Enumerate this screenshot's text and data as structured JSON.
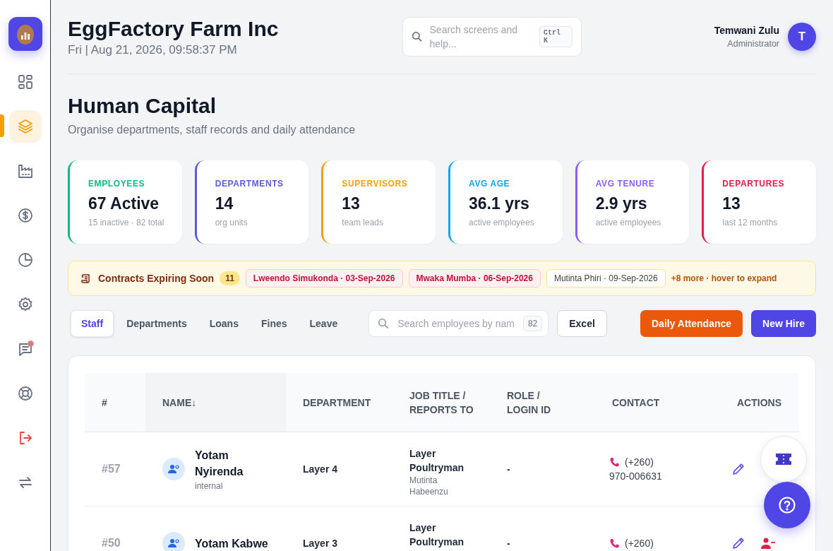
{
  "sidebar": {
    "items": [
      {
        "selected": false,
        "notification": false
      },
      {
        "selected": true,
        "notification": false
      },
      {
        "selected": false,
        "notification": false
      },
      {
        "selected": false,
        "notification": false
      },
      {
        "selected": false,
        "notification": false
      },
      {
        "selected": false,
        "notification": false
      },
      {
        "selected": false,
        "notification": true
      },
      {
        "selected": false,
        "notification": false
      },
      {
        "selected": false,
        "notification": false
      },
      {
        "selected": false,
        "notification": false
      }
    ]
  },
  "header": {
    "company": "EggFactory Farm Inc",
    "datetime": "Fri | Aug 21, 2026, 09:58:37 PM",
    "search": {
      "placeholder": "Search screens and help...",
      "shortcut": "Ctrl K"
    },
    "user": {
      "name": "Temwani Zulu",
      "role": "Administrator",
      "initial": "T"
    }
  },
  "page": {
    "title": "Human Capital",
    "subtitle": "Organise departments, staff records and daily attendance"
  },
  "stats": [
    {
      "label": "EMPLOYEES",
      "value": "67 Active",
      "note": "15 inactive · 82 total",
      "color": "#10b981"
    },
    {
      "label": "DEPARTMENTS",
      "value": "14",
      "note": "org units",
      "color": "#5b5bd6"
    },
    {
      "label": "SUPERVISORS",
      "value": "13",
      "note": "team leads",
      "color": "#f59e0b"
    },
    {
      "label": "AVG AGE",
      "value": "36.1 yrs",
      "note": "active employees",
      "color": "#0ea5e9"
    },
    {
      "label": "AVG TENURE",
      "value": "2.9 yrs",
      "note": "active employees",
      "color": "#8b5cf6"
    },
    {
      "label": "DEPARTURES",
      "value": "13",
      "note": "last 12 months",
      "color": "#e11d48"
    }
  ],
  "contracts": {
    "title": "Contracts Expiring Soon",
    "count": "11",
    "items": [
      {
        "text": "Lweendo Simukonda · 03-Sep-2026",
        "kind": "urgent"
      },
      {
        "text": "Mwaka Mumba · 06-Sep-2026",
        "kind": "urgent"
      },
      {
        "text": "Mutinta Phiri · 09-Sep-2026",
        "kind": "normal"
      }
    ],
    "more": "+8 more · hover to expand"
  },
  "tabs": [
    {
      "label": "Staff",
      "selected": true
    },
    {
      "label": "Departments",
      "selected": false
    },
    {
      "label": "Loans",
      "selected": false
    },
    {
      "label": "Fines",
      "selected": false
    },
    {
      "label": "Leave",
      "selected": false
    }
  ],
  "staff_search": {
    "placeholder": "Search employees by nam",
    "count": "82"
  },
  "buttons": [
    {
      "label": "Excel",
      "kind": "outline"
    },
    {
      "label": "Daily Attendance",
      "kind": "orange"
    },
    {
      "label": "New Hire",
      "kind": "primary"
    }
  ],
  "table": {
    "columns": [
      {
        "label": "#"
      },
      {
        "label": "NAME",
        "sort_mark": "↓"
      },
      {
        "label": "DEPARTMENT"
      },
      {
        "label": "JOB TITLE / REPORTS TO"
      },
      {
        "label": "ROLE / LOGIN ID"
      },
      {
        "label": "CONTACT"
      },
      {
        "label": "ACTIONS"
      }
    ],
    "rows": [
      {
        "number": "#57",
        "name": "Yotam Nyirenda",
        "type": "internal",
        "department": "Layer 4",
        "job_title": "Layer Poultryman",
        "reports_to": "Mutinta Habeenzu",
        "role": "-",
        "phone_code": "(+260)",
        "phone": "970-006631",
        "actions": [
          {
            "kind": "edit"
          }
        ]
      },
      {
        "number": "#50",
        "name": "Yotam Kabwe",
        "department": "Layer 3",
        "job_title": "Layer Poultryman",
        "role": "-",
        "phone_code": "(+260)",
        "actions": [
          {
            "kind": "edit"
          },
          {
            "kind": "remove"
          }
        ]
      }
    ]
  }
}
